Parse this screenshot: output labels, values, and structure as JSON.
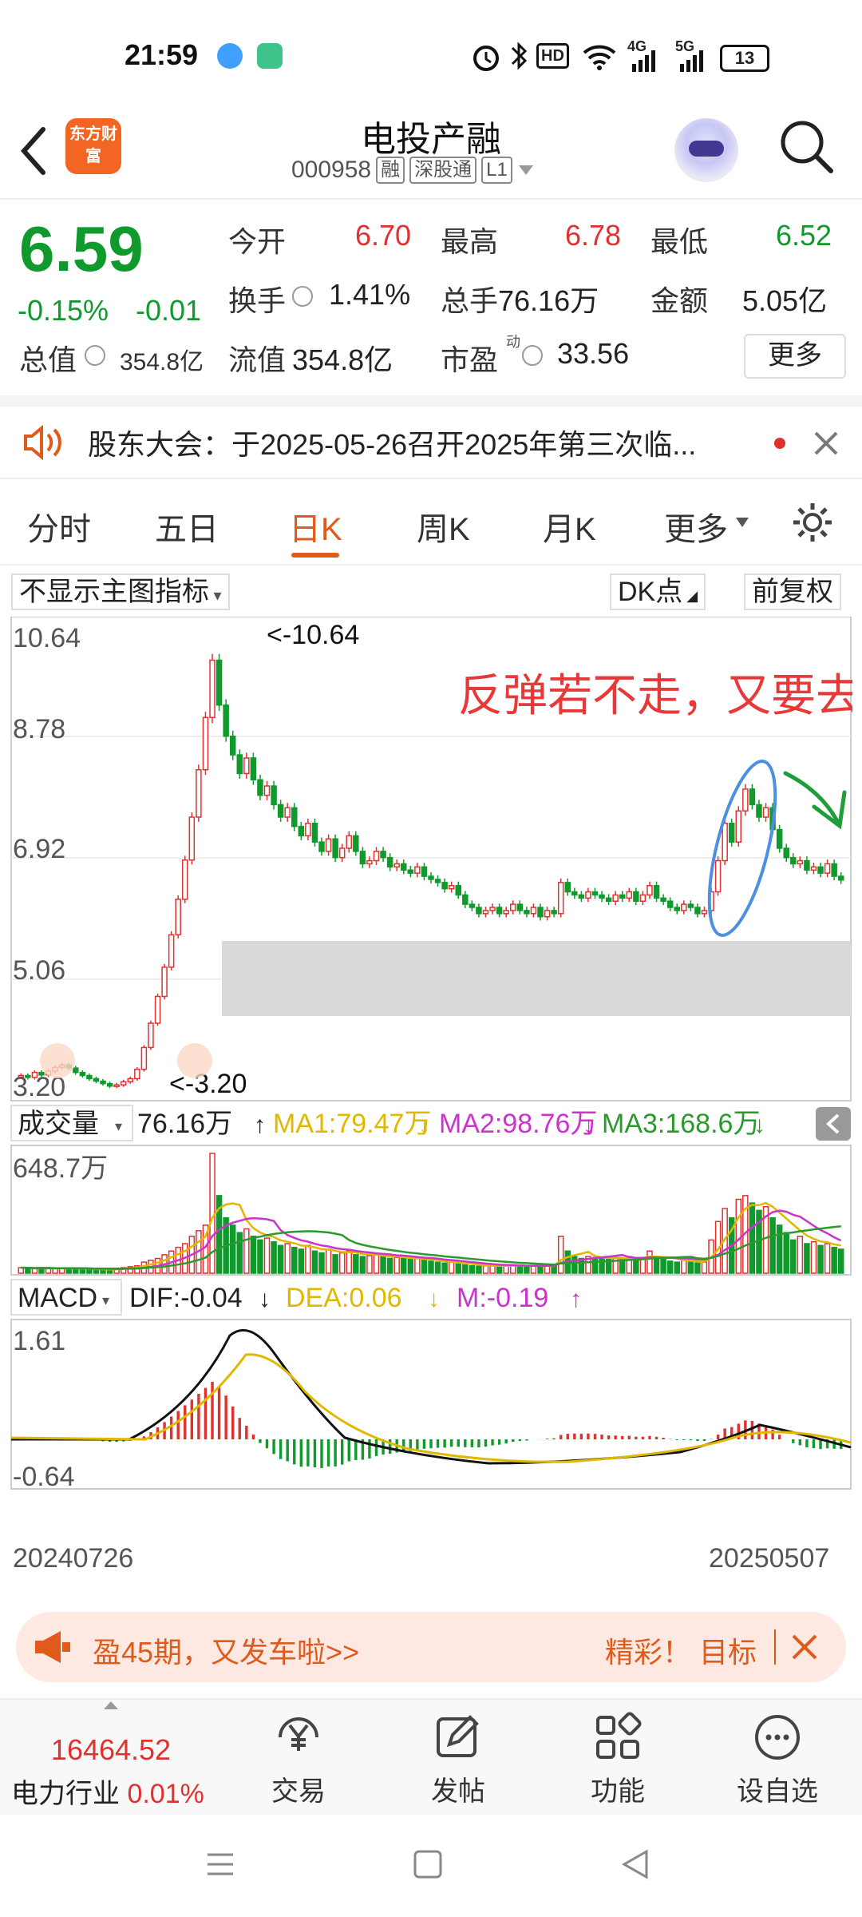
{
  "status_bar": {
    "time": "21:59",
    "signal_4g": "4G",
    "signal_5g": "5G",
    "hd": "HD",
    "battery": "13"
  },
  "header": {
    "logo_text": "东方财富",
    "stock_name": "电投产融",
    "stock_code": "000958",
    "tags": [
      "融",
      "深股通",
      "L1"
    ]
  },
  "quote": {
    "price": "6.59",
    "change_pct": "-0.15%",
    "change": "-0.01",
    "rows": [
      {
        "label": "今开",
        "value": "6.70",
        "color": "red"
      },
      {
        "label": "最高",
        "value": "6.78",
        "color": "red"
      },
      {
        "label": "最低",
        "value": "6.52",
        "color": "green"
      }
    ],
    "row2": [
      {
        "label": "换手",
        "value": "1.41%"
      },
      {
        "label": "总手",
        "value": "76.16万"
      },
      {
        "label": "金额",
        "value": "5.05亿"
      }
    ],
    "market_cap_label": "总值",
    "market_cap": "354.8亿",
    "float_cap_label": "流值",
    "float_cap": "354.8亿",
    "pe_label": "市盈",
    "pe_sup": "动",
    "pe": "33.56",
    "more": "更多"
  },
  "notice": {
    "text": "股东大会：于2025-05-26召开2025年第三次临..."
  },
  "tabs": [
    "分时",
    "五日",
    "日K",
    "周K",
    "月K",
    "更多"
  ],
  "active_tab": "日K",
  "chart_toolbar": {
    "indicator_select": "不显示主图指标",
    "dk_point": "DK点",
    "adjust": "前复权"
  },
  "chart_data": [
    {
      "type": "candlestick",
      "y_ticks": [
        "10.64",
        "8.78",
        "6.92",
        "5.06",
        "3.20"
      ],
      "ylim": [
        3.2,
        10.64
      ],
      "max_label": "<-10.64",
      "min_label": "<-3.20",
      "annotation": "反弹若不走，又要去挨刀。",
      "x_start": "20240726",
      "x_end": "20250507",
      "closes": [
        3.45,
        3.42,
        3.5,
        3.46,
        3.52,
        3.58,
        3.62,
        3.57,
        3.5,
        3.45,
        3.4,
        3.36,
        3.32,
        3.28,
        3.3,
        3.35,
        3.4,
        3.55,
        3.9,
        4.29,
        4.72,
        5.19,
        5.71,
        6.28,
        6.91,
        7.6,
        8.36,
        9.2,
        10.12,
        9.4,
        8.9,
        8.6,
        8.3,
        8.55,
        8.2,
        7.95,
        8.1,
        7.8,
        7.6,
        7.75,
        7.45,
        7.3,
        7.5,
        7.2,
        7.05,
        7.25,
        6.95,
        7.1,
        7.3,
        7.05,
        6.85,
        6.9,
        7.05,
        6.95,
        6.8,
        6.85,
        6.75,
        6.7,
        6.8,
        6.65,
        6.6,
        6.55,
        6.45,
        6.5,
        6.35,
        6.2,
        6.15,
        6.05,
        6.1,
        6.15,
        6.05,
        6.1,
        6.2,
        6.1,
        6.05,
        6.15,
        6.0,
        6.1,
        6.05,
        6.55,
        6.4,
        6.35,
        6.3,
        6.4,
        6.35,
        6.3,
        6.25,
        6.35,
        6.3,
        6.4,
        6.25,
        6.35,
        6.5,
        6.3,
        6.25,
        6.15,
        6.1,
        6.2,
        6.15,
        6.05,
        6.1,
        6.4,
        6.9,
        7.5,
        7.2,
        7.7,
        8.05,
        7.8,
        7.6,
        7.75,
        7.4,
        7.1,
        6.95,
        6.85,
        6.9,
        6.75,
        6.8,
        6.7,
        6.85,
        6.65,
        6.59
      ]
    },
    {
      "type": "bar",
      "title": "成交量",
      "current": "76.16万",
      "ma1": "MA1:79.47万",
      "ma2": "MA2:98.76万",
      "ma3": "MA3:168.6万",
      "max_label": "648.7万",
      "ylim": [
        0,
        648.7
      ],
      "values": [
        30,
        28,
        25,
        30,
        27,
        24,
        26,
        28,
        25,
        22,
        20,
        18,
        20,
        22,
        25,
        30,
        35,
        40,
        60,
        70,
        80,
        100,
        120,
        140,
        160,
        200,
        230,
        260,
        648.7,
        420,
        300,
        260,
        220,
        240,
        200,
        180,
        190,
        170,
        150,
        160,
        140,
        130,
        150,
        120,
        110,
        130,
        100,
        110,
        120,
        100,
        90,
        95,
        100,
        90,
        80,
        85,
        80,
        75,
        80,
        70,
        65,
        60,
        55,
        60,
        50,
        45,
        40,
        38,
        40,
        42,
        38,
        40,
        45,
        40,
        38,
        42,
        36,
        40,
        38,
        200,
        120,
        90,
        80,
        90,
        85,
        80,
        75,
        85,
        80,
        90,
        75,
        85,
        120,
        80,
        75,
        65,
        60,
        70,
        65,
        55,
        60,
        180,
        280,
        350,
        300,
        400,
        420,
        380,
        340,
        360,
        300,
        260,
        220,
        180,
        200,
        160,
        170,
        150,
        160,
        140,
        130
      ]
    },
    {
      "type": "line",
      "title": "MACD",
      "dif": "DIF:-0.04",
      "dea": "DEA:0.06",
      "m": "M:-0.19",
      "y_ticks": [
        "1.61",
        "-0.64"
      ],
      "ylim": [
        -0.64,
        1.61
      ]
    }
  ],
  "chart_colors": {
    "up": "#e0312f",
    "down": "#109a2d",
    "ma1": "#e0b800",
    "ma2": "#cc33cc",
    "ma3": "#2a9a2a",
    "dif": "#111111",
    "dea": "#e0b800"
  },
  "ad": {
    "text": "盈45期，又发车啦>>",
    "right_text": "精彩！ 目标"
  },
  "bottom_bar": {
    "index_value": "16464.52",
    "index_name": "电力行业",
    "index_change": "0.01%",
    "items": [
      "交易",
      "发帖",
      "功能",
      "设自选"
    ]
  }
}
